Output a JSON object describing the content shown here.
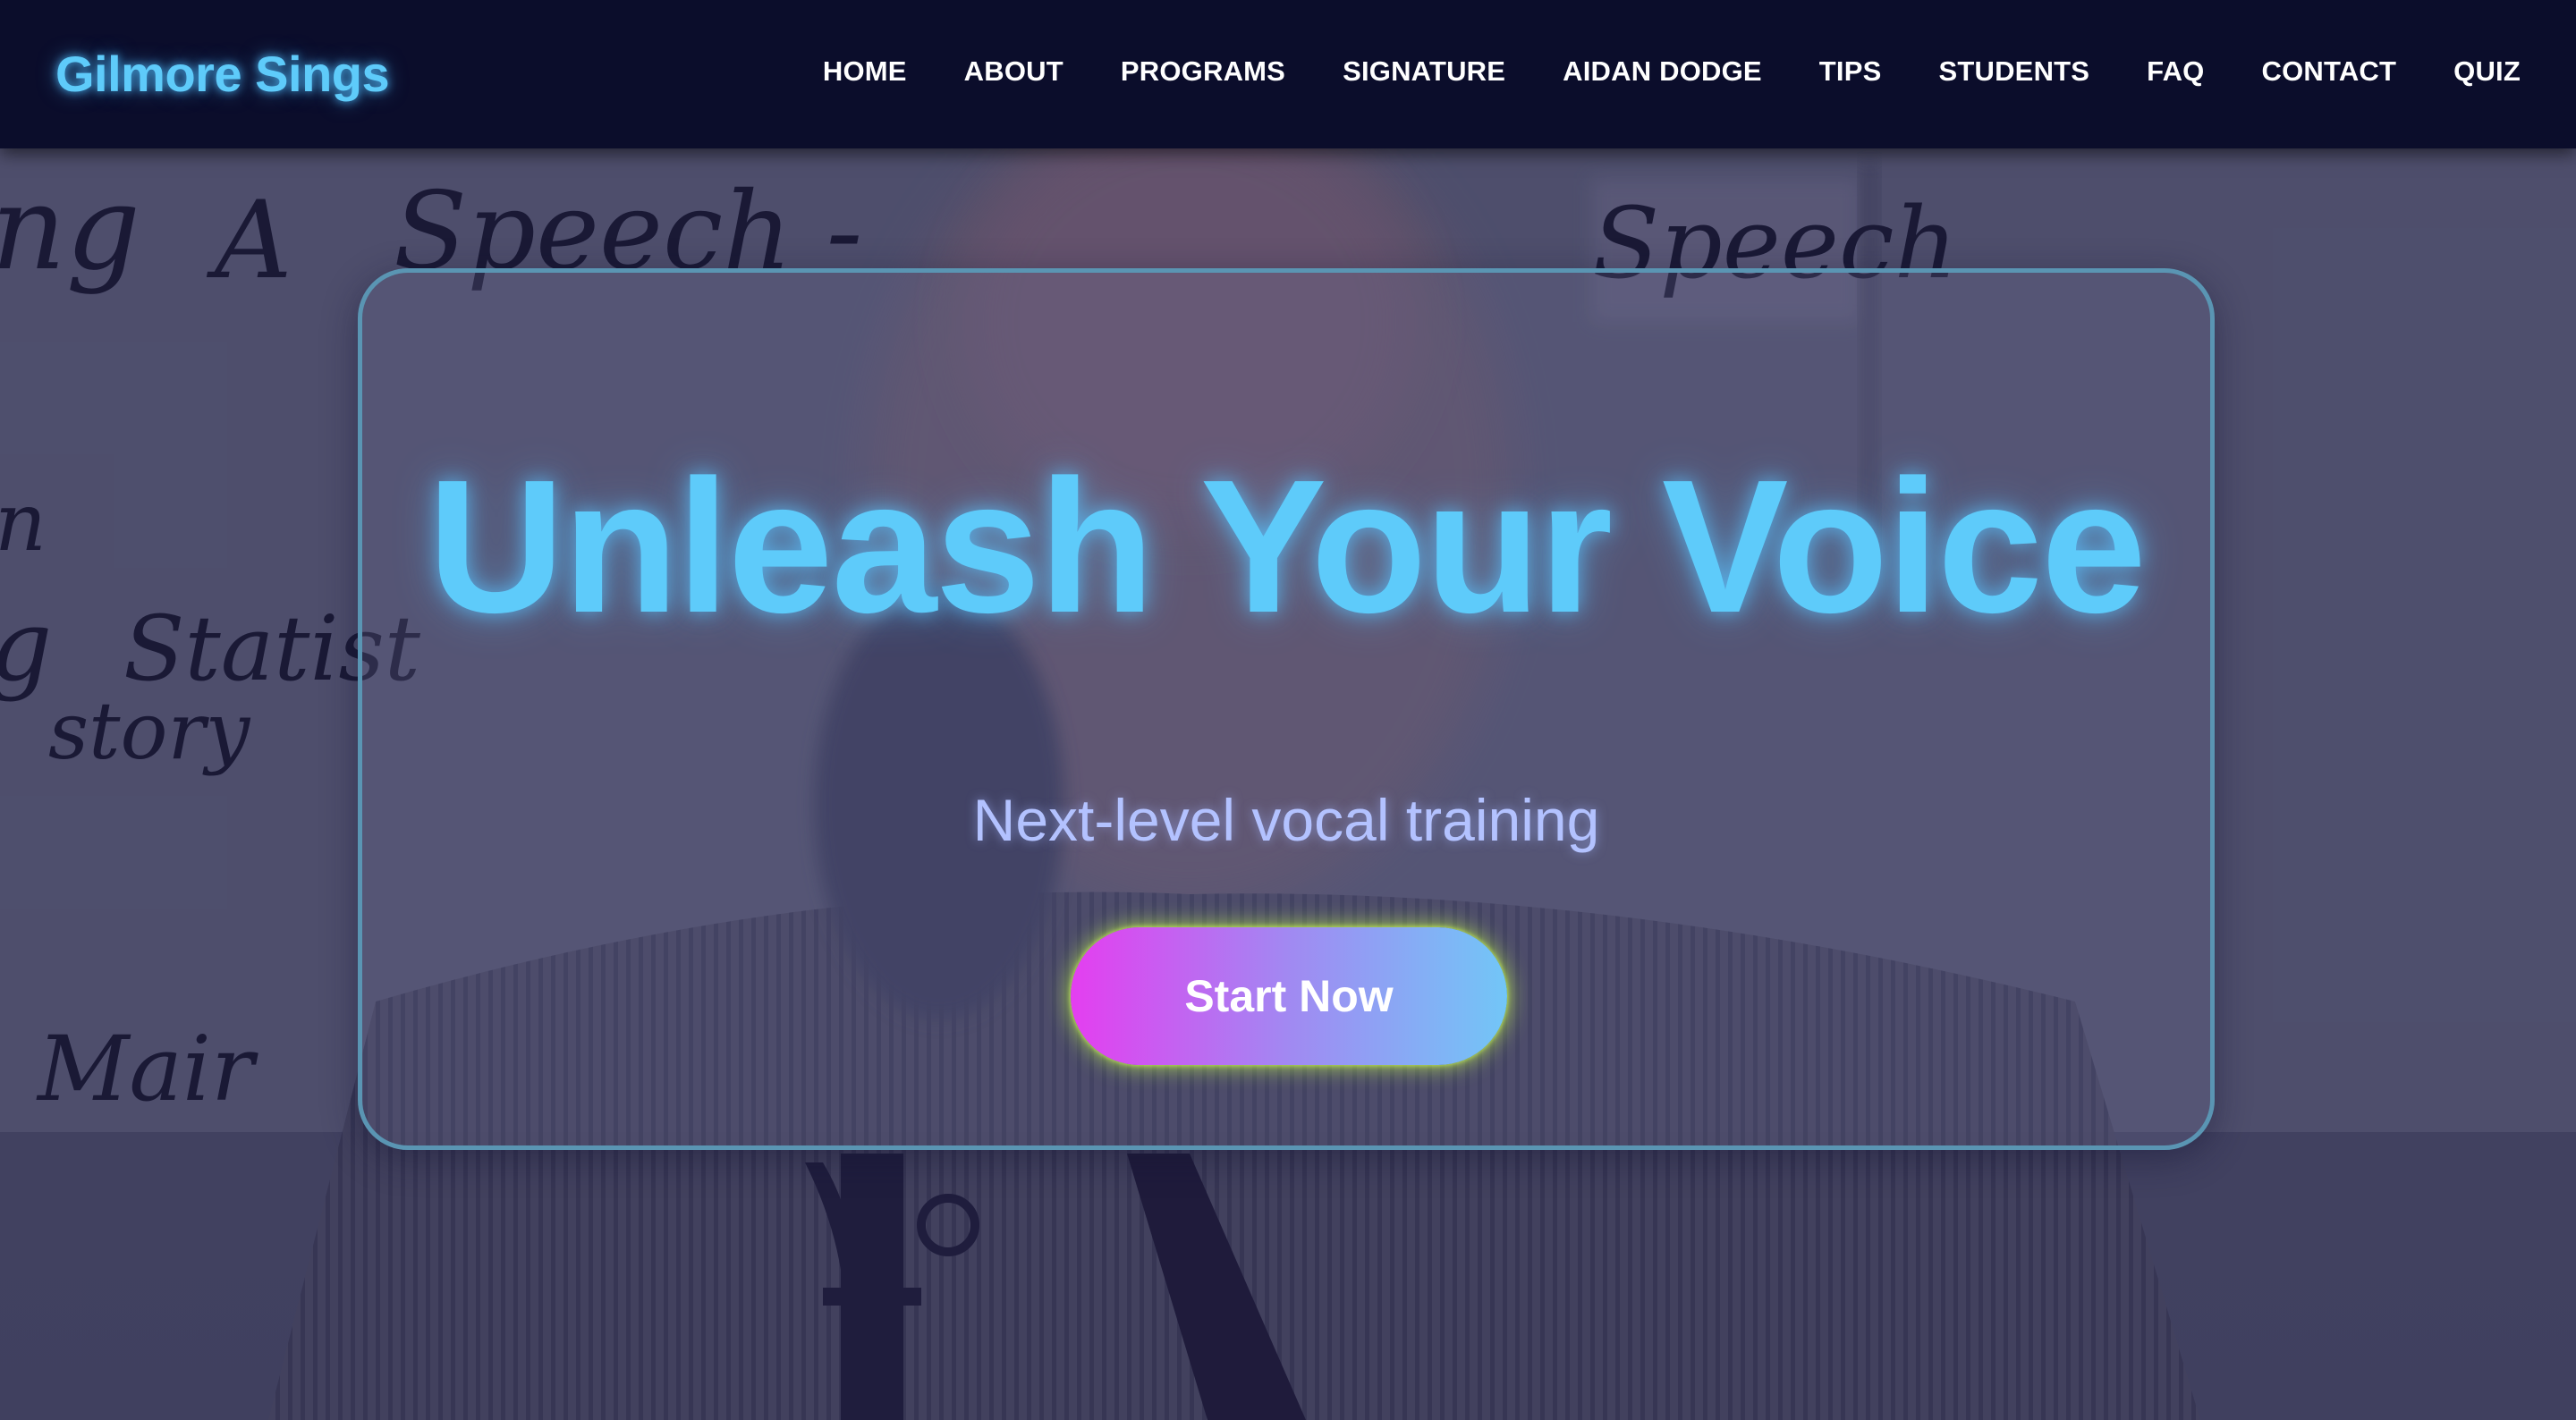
{
  "navbar": {
    "brand": "Gilmore Sings",
    "links": [
      {
        "label": "HOME"
      },
      {
        "label": "ABOUT"
      },
      {
        "label": "PROGRAMS"
      },
      {
        "label": "SIGNATURE"
      },
      {
        "label": "AIDAN DODGE"
      },
      {
        "label": "TIPS"
      },
      {
        "label": "STUDENTS"
      },
      {
        "label": "FAQ"
      },
      {
        "label": "CONTACT"
      },
      {
        "label": "QUIZ"
      }
    ]
  },
  "hero": {
    "title": "Unleash Your Voice",
    "subtitle": "Next-level vocal training",
    "cta_label": "Start Now",
    "background_whiteboard_text": [
      "ng",
      "A",
      "Speech -",
      "Speech",
      "n",
      "g",
      "Statist",
      "story",
      "Mair"
    ]
  },
  "colors": {
    "navbar_bg": "#0b0d2b",
    "brand": "#5ecbfa",
    "title": "#5ecbfa",
    "subtitle": "#b3c2ff",
    "card_border": "#5a95b3",
    "cta_gradient_start": "#e43ef0",
    "cta_gradient_end": "#72c6f7",
    "cta_glow": "#c8ff46"
  }
}
